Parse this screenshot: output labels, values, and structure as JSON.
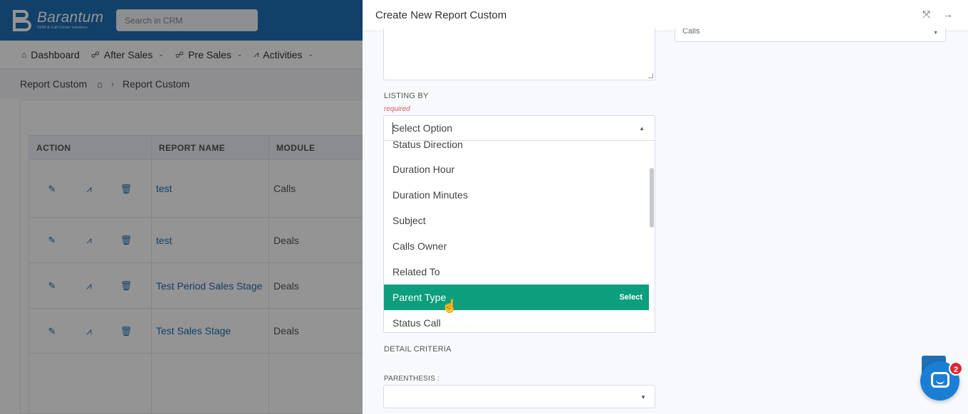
{
  "app": {
    "logo": {
      "name": "Barantum",
      "tagline": "CRM & Call Center Solutions"
    },
    "search": {
      "placeholder": "Search in CRM"
    },
    "menu": [
      {
        "label": "Dashboard",
        "icon": "home-icon"
      },
      {
        "label": "After Sales",
        "icon": "users-icon"
      },
      {
        "label": "Pre Sales",
        "icon": "users-icon"
      },
      {
        "label": "Activities",
        "icon": "activity-icon"
      }
    ],
    "breadcrumb": {
      "page": "Report Custom",
      "current": "Report Custom"
    },
    "table": {
      "headers": [
        "ACTION",
        "REPORT NAME",
        "MODULE"
      ],
      "rows": [
        {
          "name": "test",
          "module": "Calls"
        },
        {
          "name": "test",
          "module": "Deals"
        },
        {
          "name": "Test Period Sales Stage",
          "module": "Deals"
        },
        {
          "name": "Test Sales Stage",
          "module": "Deals"
        }
      ]
    }
  },
  "drawer": {
    "title": "Create New Report Custom",
    "right_select_value": "Calls",
    "listing_by": {
      "label": "LISTING BY",
      "required": "required",
      "placeholder": "Select Option",
      "options": [
        "Status Direction",
        "Duration Hour",
        "Duration Minutes",
        "Subject",
        "Calls Owner",
        "Related To",
        "Parent Type",
        "Status Call"
      ],
      "highlighted": "Parent Type",
      "select_hint": "Select"
    },
    "detail_criteria_label": "DETAIL CRITERIA",
    "parenthesis_label": "PARENTHESIS :"
  },
  "chat": {
    "badge_count": "2"
  }
}
